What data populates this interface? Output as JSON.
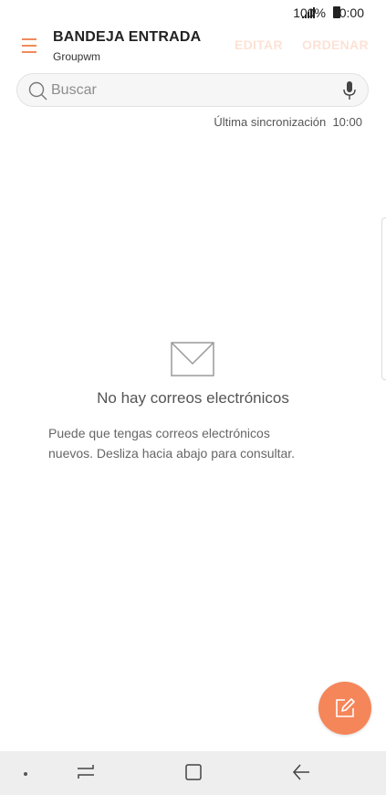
{
  "status": {
    "battery": "100%",
    "time": "10:00"
  },
  "header": {
    "title": "BANDEJA ENTRADA",
    "account": "Groupwm",
    "edit_label": "EDITAR",
    "sort_label": "ORDENAR"
  },
  "search": {
    "placeholder": "Buscar"
  },
  "sync": {
    "label": "Última sincronización",
    "time": "10:00"
  },
  "empty": {
    "title": "No hay correos electrónicos",
    "description_line1": "Puede que tengas correos electrónicos",
    "description_line2": "nuevos. Desliza hacia abajo para consultar."
  },
  "icons": {
    "menu": "hamburger-menu-icon",
    "search": "search-icon",
    "mic": "microphone-icon",
    "empty": "envelope-icon",
    "compose": "compose-icon",
    "recents": "recent-apps-icon",
    "home": "home-icon",
    "back": "back-arrow-icon"
  },
  "colors": {
    "accent": "#f5865a",
    "accent_light": "#fde2d6",
    "menu": "#f08a5d"
  }
}
